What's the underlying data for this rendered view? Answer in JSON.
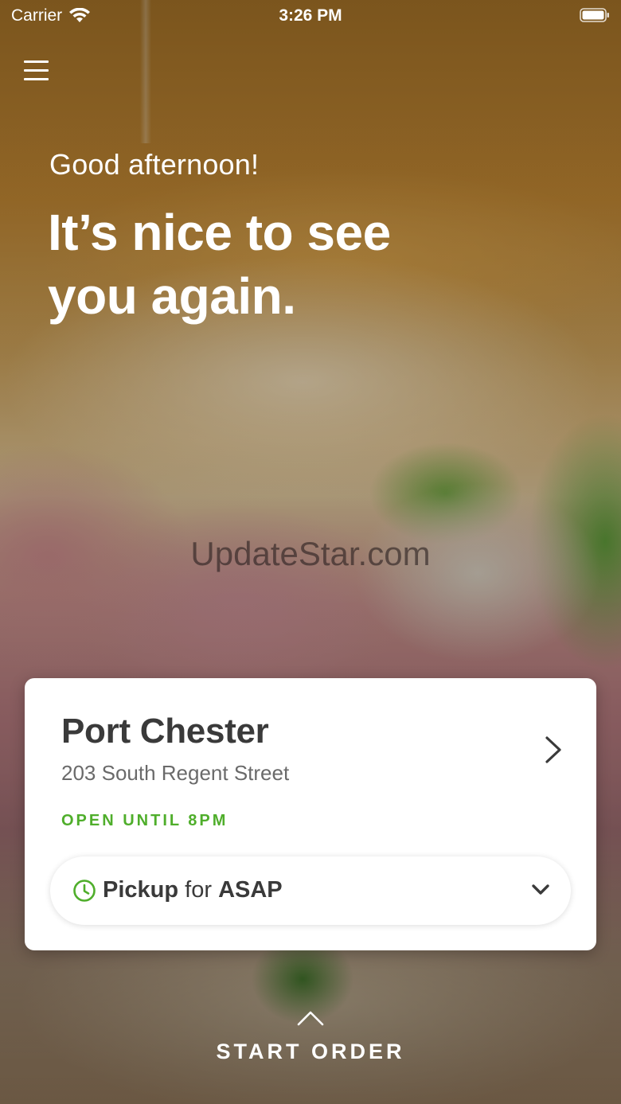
{
  "status_bar": {
    "carrier": "Carrier",
    "time": "3:26 PM",
    "wifi_icon": "wifi-icon",
    "battery_icon": "battery-icon"
  },
  "header": {
    "menu_icon": "hamburger-menu-icon"
  },
  "greeting": {
    "subtitle": "Good afternoon!",
    "headline": "It’s nice to see you again."
  },
  "watermark": "UpdateStar.com",
  "location_card": {
    "store_name": "Port Chester",
    "address": "203 South Regent Street",
    "hours_status": "OPEN UNTIL 8PM",
    "arrow_icon": "chevron-right-icon",
    "pickup": {
      "mode": "Pickup",
      "connector": "for",
      "time": "ASAP",
      "clock_icon": "clock-icon",
      "dropdown_icon": "chevron-down-icon"
    }
  },
  "footer": {
    "start_order_label": "START ORDER",
    "chevron_icon": "chevron-up-icon"
  },
  "colors": {
    "accent_green": "#4fae2b",
    "card_text": "#3a3a3a",
    "secondary_text": "#6a6a6a"
  }
}
